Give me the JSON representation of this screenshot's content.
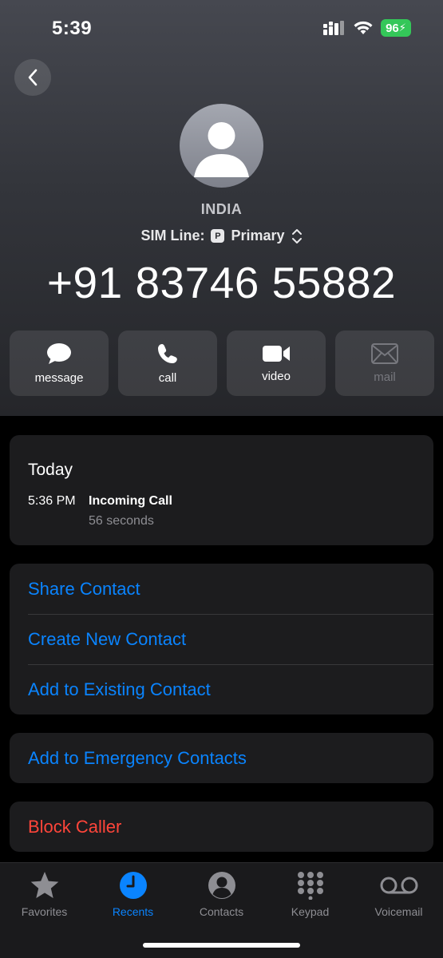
{
  "status_bar": {
    "time": "5:39",
    "battery": "96",
    "icons": [
      "cellular-icon",
      "wifi-icon",
      "battery-charging-icon"
    ]
  },
  "header": {
    "back_icon": "chevron-left-icon",
    "avatar_icon": "person-silhouette-icon",
    "caller_label": "INDIA",
    "sim_line_label": "SIM Line:",
    "sim_badge": "P",
    "sim_line_value": "Primary",
    "phone_number": "+91 83746 55882"
  },
  "actions": [
    {
      "label": "message",
      "icon": "message-bubble-icon",
      "enabled": true
    },
    {
      "label": "call",
      "icon": "phone-icon",
      "enabled": true
    },
    {
      "label": "video",
      "icon": "video-camera-icon",
      "enabled": true
    },
    {
      "label": "mail",
      "icon": "envelope-icon",
      "enabled": false
    }
  ],
  "history": {
    "day": "Today",
    "calls": [
      {
        "time": "5:36 PM",
        "type": "Incoming Call",
        "duration": "56 seconds"
      }
    ]
  },
  "contact_options": [
    "Share Contact",
    "Create New Contact",
    "Add to Existing Contact"
  ],
  "emergency_option": "Add to Emergency Contacts",
  "block_option": "Block Caller",
  "colors": {
    "accent": "#0a84ff",
    "destructive": "#ff453a",
    "card": "#1c1c1e",
    "battery": "#34c759"
  },
  "tab_bar": {
    "active": "Recents",
    "tabs": [
      {
        "label": "Favorites",
        "icon": "star-icon"
      },
      {
        "label": "Recents",
        "icon": "clock-icon"
      },
      {
        "label": "Contacts",
        "icon": "person-circle-icon"
      },
      {
        "label": "Keypad",
        "icon": "keypad-icon"
      },
      {
        "label": "Voicemail",
        "icon": "voicemail-icon"
      }
    ]
  }
}
